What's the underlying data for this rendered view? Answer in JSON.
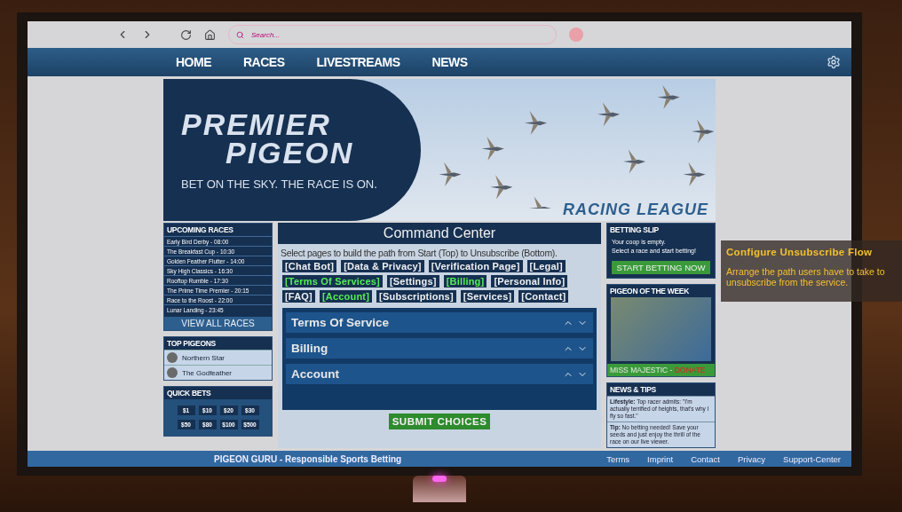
{
  "browser": {
    "search_placeholder": "Search..."
  },
  "nav": {
    "items": [
      "HOME",
      "RACES",
      "LIVESTREAMS",
      "NEWS"
    ]
  },
  "banner": {
    "title_line1": "PREMIER",
    "title_line2": "PIGEON",
    "tagline": "BET ON THE SKY. THE RACE IS ON.",
    "subtitle": "RACING LEAGUE"
  },
  "upcoming_races": {
    "title": "UPCOMING RACES",
    "items": [
      "Early Bird Derby - 08:00",
      "The Breakfast Cup - 10:30",
      "Golden Feather Flutter - 14:00",
      "Sky High Classics - 16:30",
      "Rooftop Rumble - 17:30",
      "The Prime Time Premier - 20:15",
      "Race to the Roost - 22:00",
      "Lunar Landing - 23:45"
    ],
    "button": "VIEW ALL RACES"
  },
  "top_pigeons": {
    "title": "TOP PIGEONS",
    "items": [
      "Northern Star",
      "The Godfeather"
    ]
  },
  "quick_bets": {
    "title": "QUICK BETS",
    "amounts": [
      "$1",
      "$10",
      "$20",
      "$30",
      "$50",
      "$80",
      "$100",
      "$500"
    ]
  },
  "command_center": {
    "title": "Command Center",
    "instruction": "Select pages to build the path from Start (Top) to Unsubscribe (Bottom).",
    "pages": [
      {
        "label": "[Chat Bot]",
        "selected": false
      },
      {
        "label": "[Data & Privacy]",
        "selected": false
      },
      {
        "label": "[Verification Page]",
        "selected": false
      },
      {
        "label": "[Legal]",
        "selected": false
      },
      {
        "label": "[Terms Of Services]",
        "selected": true
      },
      {
        "label": "[Settings]",
        "selected": false
      },
      {
        "label": "[Billing]",
        "selected": true
      },
      {
        "label": "[Personal Info]",
        "selected": false
      },
      {
        "label": "[FAQ]",
        "selected": false
      },
      {
        "label": "[Account]",
        "selected": true
      },
      {
        "label": "[Subscriptions]",
        "selected": false
      },
      {
        "label": "[Services]",
        "selected": false
      },
      {
        "label": "[Contact]",
        "selected": false
      }
    ],
    "path": [
      "Terms Of Service",
      "Billing",
      "Account"
    ],
    "submit": "SUBMIT CHOICES"
  },
  "betting_slip": {
    "title": "BETTING SLIP",
    "lines": [
      "Your coop is empty.",
      "Select a race and start betting!"
    ],
    "button": "START BETTING NOW"
  },
  "pigeon_of_week": {
    "title": "PIGEON OF THE WEEK",
    "name": "MISS MAJESTIC - ",
    "link": "DONATE"
  },
  "news": {
    "title": "NEWS & TIPS",
    "items": [
      {
        "label": "Lifestyle:",
        "text": " Top racer admits: \"I'm actually terrified of heights, that's why I fly so fast.\""
      },
      {
        "label": "Tip:",
        "text": " No betting needed! Save your seeds and just enjoy the thrill of the race on our live viewer."
      }
    ]
  },
  "footer": {
    "brand": "PIGEON GURU - Responsible Sports Betting",
    "links": [
      "Terms",
      "Imprint",
      "Contact",
      "Privacy",
      "Support-Center"
    ]
  },
  "task": {
    "title": "Configure Unsubscribe Flow",
    "text": "Arrange the path users have to take to unsubscribe from the service."
  }
}
